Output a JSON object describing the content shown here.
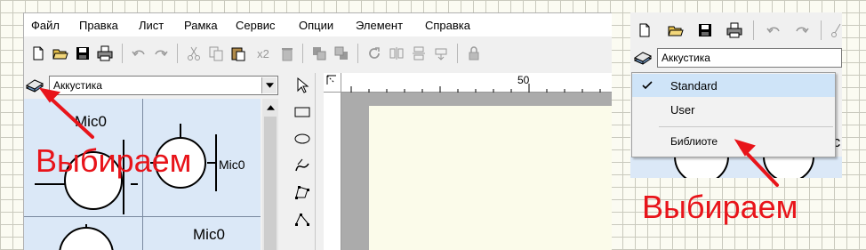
{
  "menu": [
    "Файл",
    "Правка",
    "Лист",
    "Рамка",
    "Сервис",
    "Опции",
    "Элемент",
    "Справка"
  ],
  "toolbar": {
    "x2_label": "x2"
  },
  "library": {
    "selected": "Аккустика"
  },
  "cells": {
    "label_1": "Mic0",
    "label_2": "Mic0",
    "label_3": "Mic0"
  },
  "ruler": {
    "mark": "50"
  },
  "popup": {
    "combo_value": "Аккустика",
    "items": [
      "Standard",
      "User"
    ],
    "library_item": "Библиоте",
    "peek_text": "ic"
  },
  "annotations": {
    "left": "Выбираем",
    "right": "Выбираем"
  },
  "colors": {
    "annotation": "#e8141a",
    "cell_bg": "#dbe8f7",
    "selected_item": "#cfe4f8"
  }
}
